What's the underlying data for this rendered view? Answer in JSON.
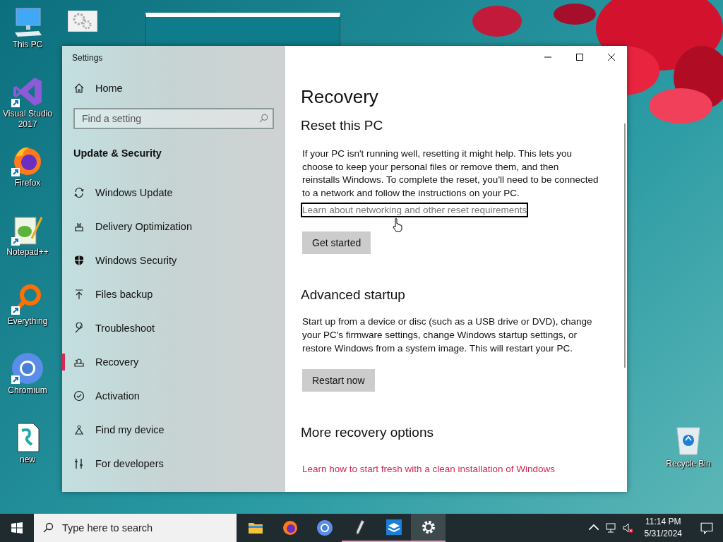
{
  "desktop_icons": [
    {
      "kind": "computer",
      "label": "This PC"
    },
    {
      "kind": "vs",
      "label": "Visual Studio 2017",
      "shortcut": true
    },
    {
      "kind": "firefox",
      "label": "Firefox",
      "shortcut": true
    },
    {
      "kind": "notepad",
      "label": "Notepad++",
      "shortcut": true
    },
    {
      "kind": "everything",
      "label": "Everything",
      "shortcut": true
    },
    {
      "kind": "chromium",
      "label": "Chromium",
      "shortcut": true
    },
    {
      "kind": "script",
      "label": "new"
    }
  ],
  "recycle_bin": {
    "label": "Recycle Bin"
  },
  "window": {
    "title": "Settings"
  },
  "sidebar": {
    "home": "Home",
    "search": {
      "placeholder": "Find a setting"
    },
    "section": "Update & Security",
    "items": [
      {
        "kind": "sync",
        "label": "Windows Update",
        "selected": false
      },
      {
        "kind": "delivery",
        "label": "Delivery Optimization",
        "selected": false
      },
      {
        "kind": "shield",
        "label": "Windows Security",
        "selected": false
      },
      {
        "kind": "upload",
        "label": "Files backup",
        "selected": false
      },
      {
        "kind": "wrench",
        "label": "Troubleshoot",
        "selected": false
      },
      {
        "kind": "recovery",
        "label": "Recovery",
        "selected": true
      },
      {
        "kind": "check",
        "label": "Activation",
        "selected": false
      },
      {
        "kind": "person",
        "label": "Find my device",
        "selected": false
      },
      {
        "kind": "tools",
        "label": "For developers",
        "selected": false
      }
    ]
  },
  "content": {
    "title": "Recovery",
    "sections": [
      {
        "heading": "Reset this PC",
        "text": "If your PC isn't running well, resetting it might help. This lets you choose to keep your personal files or remove them, and then reinstalls Windows. To complete the reset, you'll need to be connected to a network and follow the instructions on your PC.",
        "link": "Learn about networking and other reset requirements",
        "link_focused": true,
        "button": "Get started"
      },
      {
        "heading": "Advanced startup",
        "text": "Start up from a device or disc (such as a USB drive or DVD), change your PC's firmware settings, change Windows startup settings, or restore Windows from a system image. This will restart your PC.",
        "button": "Restart now"
      },
      {
        "heading": "More recovery options",
        "link": "Learn how to start fresh with a clean installation of Windows",
        "link_focused": false
      }
    ]
  },
  "taskbar": {
    "search": {
      "placeholder": "Type here to search"
    },
    "apps": [
      {
        "kind": "folder",
        "running": false,
        "selected": false
      },
      {
        "kind": "firefox",
        "running": false,
        "selected": false
      },
      {
        "kind": "chromium",
        "running": false,
        "selected": false
      },
      {
        "kind": "pen",
        "running": true,
        "selected": false
      },
      {
        "kind": "box",
        "running": true,
        "selected": false
      },
      {
        "kind": "gear",
        "running": true,
        "selected": true
      }
    ],
    "time": "11:14 PM",
    "date": "5/31/2024"
  }
}
